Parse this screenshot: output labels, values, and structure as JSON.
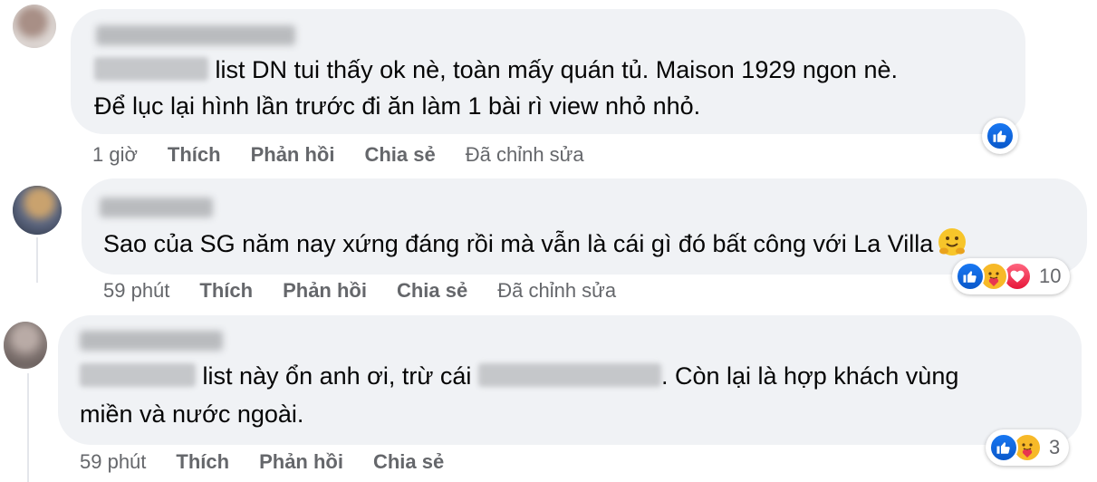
{
  "comments": [
    {
      "author": "",
      "text_lines": [
        {
          "after_mention": "list DN tui thấy ok nè, toàn mấy quán tủ. Maison 1929 ngon nè."
        },
        {
          "text": "Để lục lại hình lần trước đi ăn làm 1 bài rì view nhỏ nhỏ."
        }
      ],
      "time": "1 giờ",
      "like_label": "Thích",
      "reply_label": "Phản hồi",
      "share_label": "Chia sẻ",
      "edited_label": "Đã chỉnh sửa",
      "reactions": [
        "like-icon"
      ],
      "reaction_count": ""
    },
    {
      "author": "",
      "text_lines": [
        {
          "text": "Sao của SG năm nay xứng đáng rồi mà vẫn là cái gì đó bất công với La Villa"
        }
      ],
      "time": "59 phút",
      "like_label": "Thích",
      "reply_label": "Phản hồi",
      "share_label": "Chia sẻ",
      "edited_label": "Đã chỉnh sửa",
      "reactions": [
        "like-icon",
        "care-icon",
        "love-icon"
      ],
      "reaction_count": "10"
    },
    {
      "author": "",
      "text_lines": [
        {
          "after_mention": "list này ổn anh ơi, trừ cái",
          "after_redaction": ". Còn lại là hợp khách vùng"
        },
        {
          "text": "miền và nước ngoài."
        }
      ],
      "time": "59 phút",
      "like_label": "Thích",
      "reply_label": "Phản hồi",
      "share_label": "Chia sẻ",
      "edited_label": "",
      "reactions": [
        "like-icon",
        "care-icon"
      ],
      "reaction_count": "3"
    }
  ],
  "colors": {
    "bubble": "#f0f2f5",
    "meta_text": "#65676b",
    "like_blue": "#1877f2",
    "love_red": "#f33e58",
    "care_yellow": "#f7b928"
  }
}
